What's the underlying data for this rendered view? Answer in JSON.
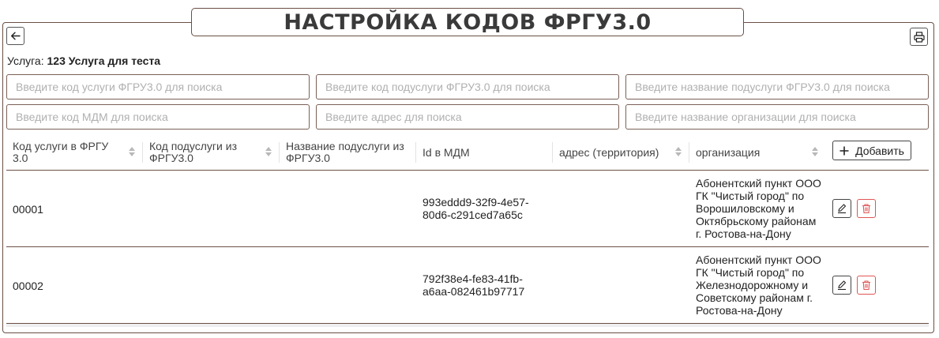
{
  "page": {
    "title": "НАСТРОЙКА КОДОВ ФРГУ3.0"
  },
  "toolbar": {
    "back_icon": "arrow-left-icon",
    "print_icon": "printer-icon"
  },
  "service": {
    "label": "Услуга:",
    "value": "123 Услуга для теста"
  },
  "search": {
    "service_code": {
      "value": "",
      "placeholder": "Введите код услуги ФГРУ3.0 для поиска"
    },
    "subservice_code": {
      "value": "",
      "placeholder": "Введите код подуслуги ФГРУ3.0 для поиска"
    },
    "subservice_name": {
      "value": "",
      "placeholder": "Введите название подуслуги ФГРУ3.0 для поиска"
    },
    "mdm_code": {
      "value": "",
      "placeholder": "Введите код МДМ для поиска"
    },
    "address": {
      "value": "",
      "placeholder": "Введите адрес для поиска"
    },
    "org_name": {
      "value": "",
      "placeholder": "Введите название организации для поиска"
    }
  },
  "table": {
    "columns": [
      "Код услуги в ФРГУ 3.0",
      "Код подуслуги из ФРГУ3.0",
      "Название подуслуги из ФРГУ3.0",
      "Id в МДМ",
      "адрес (территория)",
      "организация"
    ],
    "add_label": "Добавить",
    "rows": [
      {
        "service_code": "00001",
        "subservice_code": "",
        "subservice_name": "",
        "mdm_id": "993eddd9-32f9-4e57-80d6-c291ced7a65c",
        "address": "",
        "organization": "Абонентский пункт ООО ГК \"Чистый город\" по Ворошиловскому и Октябрьскому районам г. Ростова-на-Дону"
      },
      {
        "service_code": "00002",
        "subservice_code": "",
        "subservice_name": "",
        "mdm_id": "792f38e4-fe83-41fb-a6aa-082461b97717",
        "address": "",
        "organization": "Абонентский пункт ООО ГК \"Чистый город\" по Железнодорожному и Советскому районам г. Ростова-на-Дону"
      }
    ]
  },
  "colors": {
    "border": "#6b4f45",
    "danger": "#e05555",
    "placeholder": "#b0b0b0"
  }
}
